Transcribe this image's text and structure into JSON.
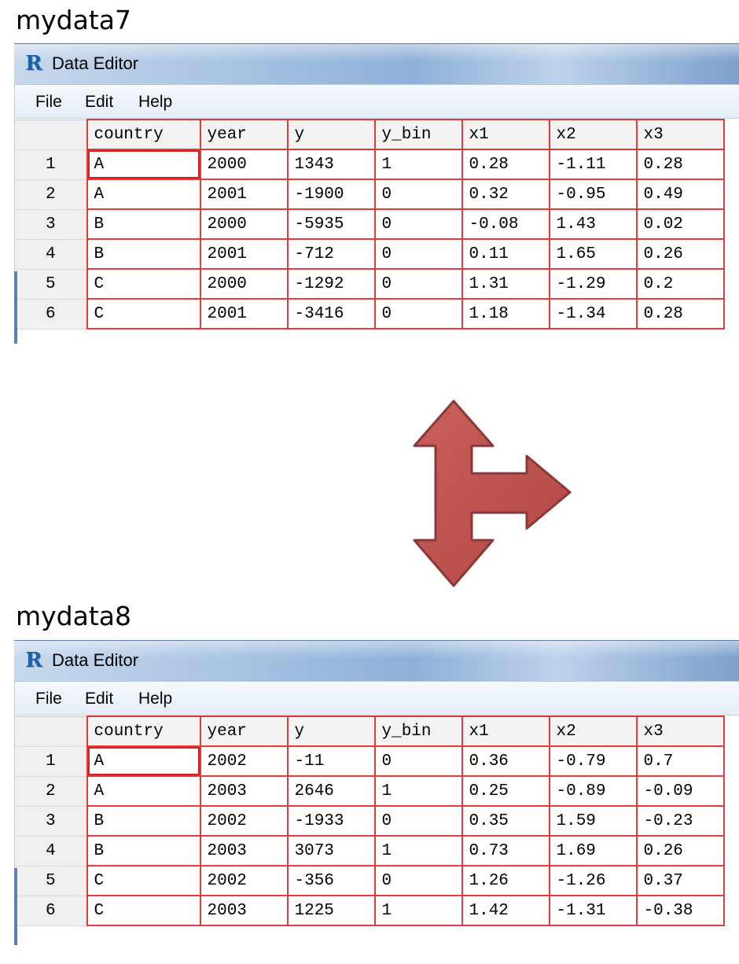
{
  "top": {
    "dataset_label": "mydata7",
    "window_title": "Data Editor",
    "menu": [
      "File",
      "Edit",
      "Help"
    ],
    "columns": [
      "country",
      "year",
      "y",
      "y_bin",
      "x1",
      "x2",
      "x3"
    ],
    "rows": [
      {
        "num": "1",
        "cells": [
          "A",
          "2000",
          "1343",
          "1",
          "0.28",
          "-1.11",
          "0.28"
        ]
      },
      {
        "num": "2",
        "cells": [
          "A",
          "2001",
          "-1900",
          "0",
          "0.32",
          "-0.95",
          "0.49"
        ]
      },
      {
        "num": "3",
        "cells": [
          "B",
          "2000",
          "-5935",
          "0",
          "-0.08",
          "1.43",
          "0.02"
        ]
      },
      {
        "num": "4",
        "cells": [
          "B",
          "2001",
          "-712",
          "0",
          "0.11",
          "1.65",
          "0.26"
        ]
      },
      {
        "num": "5",
        "cells": [
          "C",
          "2000",
          "-1292",
          "0",
          "1.31",
          "-1.29",
          "0.2"
        ]
      },
      {
        "num": "6",
        "cells": [
          "C",
          "2001",
          "-3416",
          "0",
          "1.18",
          "-1.34",
          "0.28"
        ]
      }
    ]
  },
  "bottom": {
    "dataset_label": "mydata8",
    "window_title": "Data Editor",
    "menu": [
      "File",
      "Edit",
      "Help"
    ],
    "columns": [
      "country",
      "year",
      "y",
      "y_bin",
      "x1",
      "x2",
      "x3"
    ],
    "rows": [
      {
        "num": "1",
        "cells": [
          "A",
          "2002",
          "-11",
          "0",
          "0.36",
          "-0.79",
          "0.7"
        ]
      },
      {
        "num": "2",
        "cells": [
          "A",
          "2003",
          "2646",
          "1",
          "0.25",
          "-0.89",
          "-0.09"
        ]
      },
      {
        "num": "3",
        "cells": [
          "B",
          "2002",
          "-1933",
          "0",
          "0.35",
          "1.59",
          "-0.23"
        ]
      },
      {
        "num": "4",
        "cells": [
          "B",
          "2003",
          "3073",
          "1",
          "0.73",
          "1.69",
          "0.26"
        ]
      },
      {
        "num": "5",
        "cells": [
          "C",
          "2002",
          "-356",
          "0",
          "1.26",
          "-1.26",
          "0.37"
        ]
      },
      {
        "num": "6",
        "cells": [
          "C",
          "2003",
          "1225",
          "1",
          "1.42",
          "-1.31",
          "-0.38"
        ]
      }
    ]
  },
  "icons": {
    "app_icon": "r-logo-icon",
    "connector": "three-way-arrow-icon"
  },
  "colors": {
    "grid_border": "#e33a3a",
    "arrow_fill": "#c0504d",
    "arrow_stroke": "#8c3836",
    "titlebar": "#9bb9de"
  }
}
